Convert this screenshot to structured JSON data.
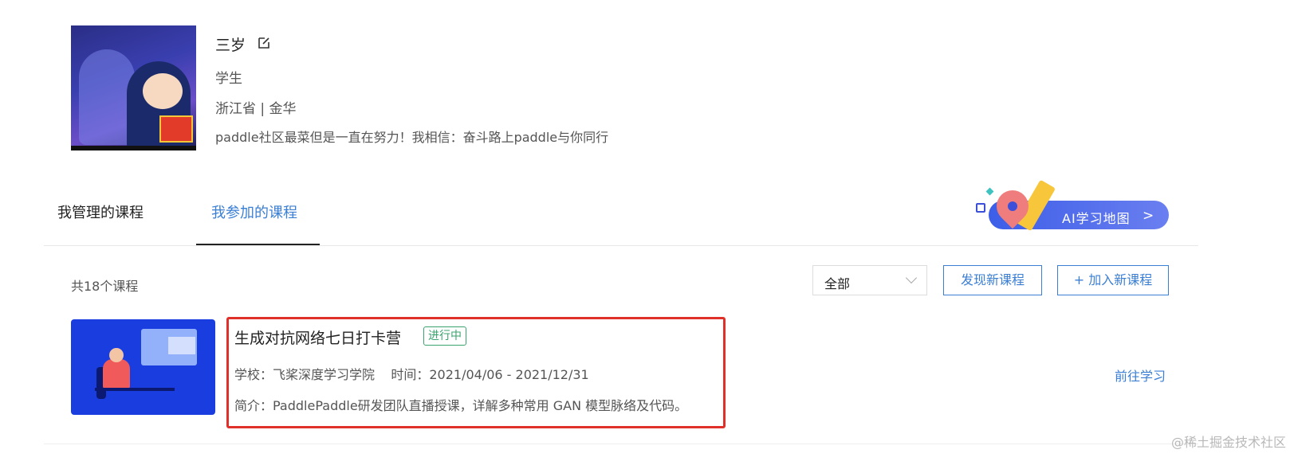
{
  "profile": {
    "name": "三岁",
    "role": "学生",
    "location": "浙江省 | 金华",
    "bio": "paddle社区最菜但是一直在努力！我相信：奋斗路上paddle与你同行"
  },
  "tabs": [
    {
      "label": "我管理的课程",
      "active": false
    },
    {
      "label": "我参加的课程",
      "active": true
    }
  ],
  "ai_map": {
    "label": "AI学习地图",
    "chevron": ">"
  },
  "toolbar": {
    "course_count": "共18个课程",
    "filter_selected": "全部",
    "discover_button": "发现新课程",
    "add_button": "+ 加入新课程"
  },
  "courses": [
    {
      "title": "生成对抗网络七日打卡营",
      "status": "进行中",
      "meta": "学校：飞桨深度学习学院    时间：2021/04/06 - 2021/12/31",
      "description": "简介：PaddlePaddle研发团队直播授课，详解多种常用 GAN 模型脉络及代码。",
      "action": "前往学习"
    }
  ],
  "watermark": "@稀土掘金技术社区",
  "colors": {
    "accent": "#3b7fd4",
    "status_green": "#3aa36e",
    "highlight_red": "#e0302a"
  }
}
